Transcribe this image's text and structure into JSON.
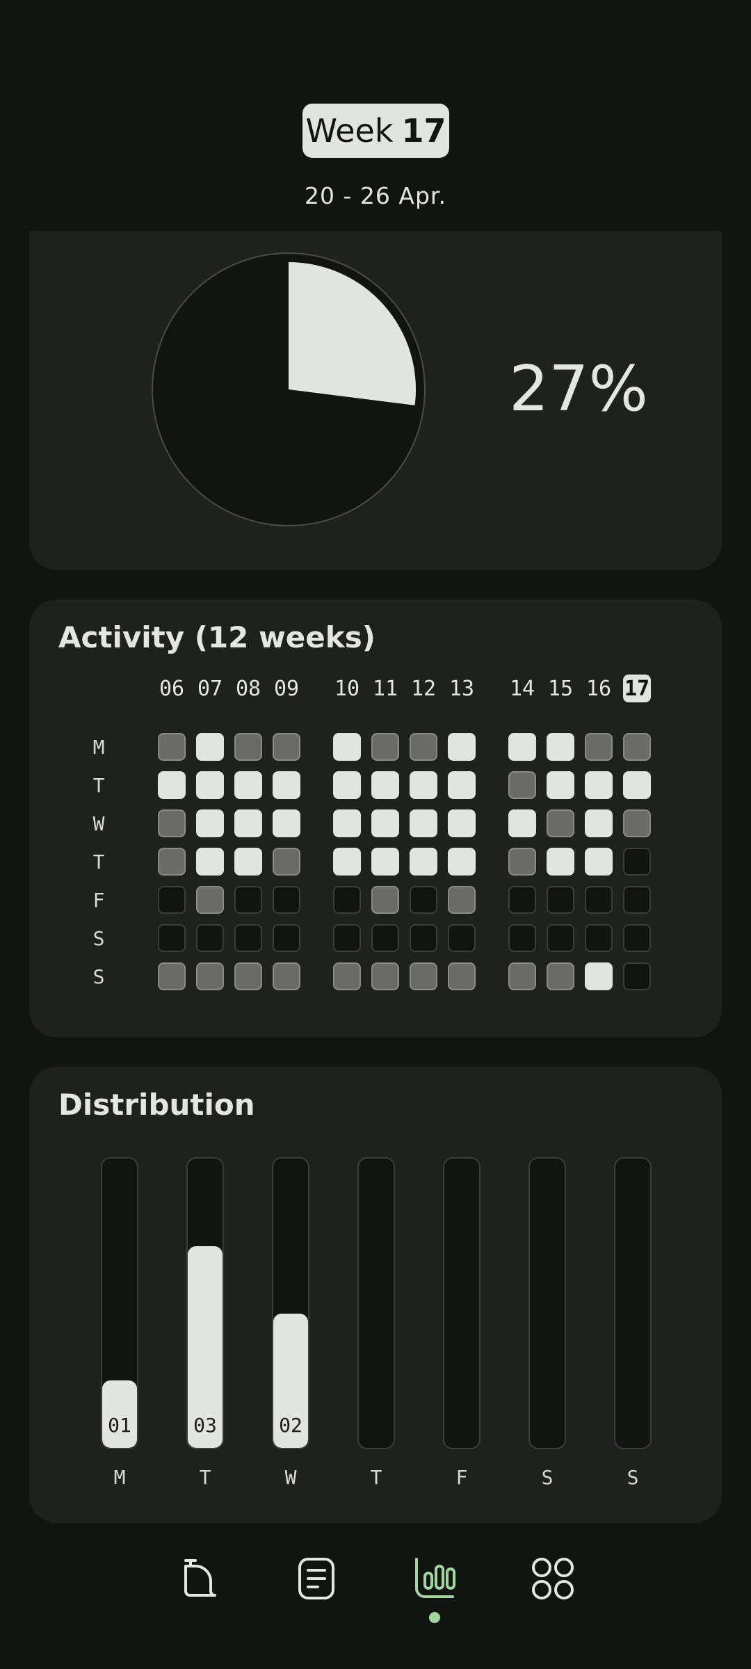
{
  "header": {
    "week_word": "Week",
    "week_number": "17",
    "date_range": "20 - 26 Apr."
  },
  "progress": {
    "percent_text": "27%",
    "fraction": 0.27
  },
  "activity": {
    "title": "Activity (12 weeks)",
    "weeks": [
      "06",
      "07",
      "08",
      "09",
      "10",
      "11",
      "12",
      "13",
      "14",
      "15",
      "16",
      "17"
    ],
    "current_week": "17",
    "days": [
      "M",
      "T",
      "W",
      "T",
      "F",
      "S",
      "S"
    ],
    "grid": [
      [
        1,
        2,
        1,
        1,
        2,
        1,
        1,
        2,
        2,
        2,
        1,
        1
      ],
      [
        2,
        2,
        2,
        2,
        2,
        2,
        2,
        2,
        1,
        2,
        2,
        2
      ],
      [
        1,
        2,
        2,
        2,
        2,
        2,
        2,
        2,
        2,
        1,
        2,
        1
      ],
      [
        1,
        2,
        2,
        1,
        2,
        2,
        2,
        2,
        1,
        2,
        2,
        0
      ],
      [
        0,
        1,
        0,
        0,
        0,
        1,
        0,
        1,
        0,
        0,
        0,
        0
      ],
      [
        0,
        0,
        0,
        0,
        0,
        0,
        0,
        0,
        0,
        0,
        0,
        0
      ],
      [
        1,
        1,
        1,
        1,
        1,
        1,
        1,
        1,
        1,
        1,
        2,
        0
      ]
    ]
  },
  "distribution": {
    "title": "Distribution",
    "days": [
      "M",
      "T",
      "W",
      "T",
      "F",
      "S",
      "S"
    ],
    "values": [
      1,
      3,
      2,
      0,
      0,
      0,
      0
    ],
    "labels": [
      "01",
      "03",
      "02",
      "",
      "",
      "",
      ""
    ],
    "max": 4.3
  },
  "nav": {
    "items": [
      {
        "name": "timer-icon",
        "active": false
      },
      {
        "name": "notes-icon",
        "active": false
      },
      {
        "name": "stats-icon",
        "active": true
      },
      {
        "name": "grid-icon",
        "active": false
      }
    ],
    "accent": "#9fd79f"
  }
}
